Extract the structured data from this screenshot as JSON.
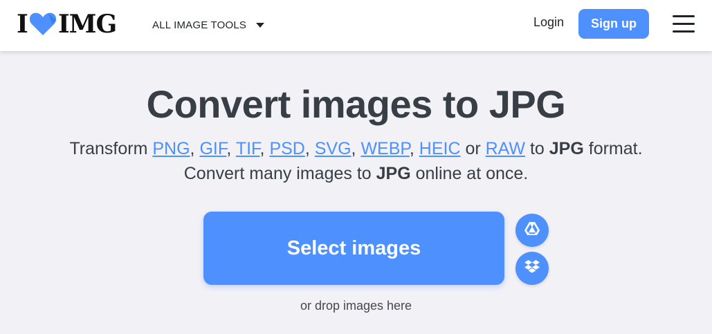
{
  "header": {
    "logo_left": "I",
    "logo_right": "IMG",
    "tools_label": "ALL IMAGE TOOLS",
    "login_label": "Login",
    "signup_label": "Sign up"
  },
  "main": {
    "title": "Convert images to JPG",
    "subtitle_line1": {
      "prefix": "Transform ",
      "formats": [
        "PNG",
        "GIF",
        "TIF",
        "PSD",
        "SVG",
        "WEBP",
        "HEIC"
      ],
      "or": " or ",
      "last_format": "RAW",
      "to": " to ",
      "target": "JPG",
      "suffix": " format."
    },
    "subtitle_line2": {
      "prefix": "Convert many images to ",
      "target": "JPG",
      "suffix": " online at once."
    },
    "select_button": "Select images",
    "drop_hint": "or drop images here"
  },
  "colors": {
    "accent": "#4d90fe",
    "text": "#383e45",
    "background": "#f2f1f6",
    "heart": "#4d90fe"
  },
  "icons": {
    "logo_mark": "heart-icon",
    "tools_caret": "caret-down-icon",
    "menu": "hamburger-menu-icon",
    "cloud_1": "google-drive-icon",
    "cloud_2": "dropbox-icon"
  }
}
